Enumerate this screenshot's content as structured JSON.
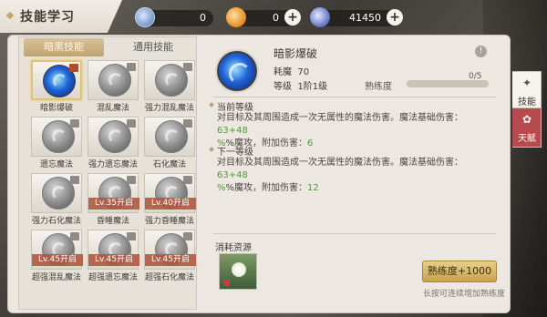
{
  "title": "技能学习",
  "resources": [
    {
      "name": "diamond",
      "value": "0",
      "has_plus": false,
      "icon": "diamond-icon"
    },
    {
      "name": "gold-coin",
      "value": "0",
      "has_plus": true,
      "icon": "coin-icon"
    },
    {
      "name": "silver",
      "value": "41450",
      "has_plus": true,
      "icon": "silver-icon"
    }
  ],
  "tabs": {
    "active": "暗黑技能",
    "inactive": "通用技能"
  },
  "skills": [
    {
      "name": "暗影爆破",
      "lock": "",
      "selected": true
    },
    {
      "name": "混乱魔法",
      "lock": ""
    },
    {
      "name": "强力混乱魔法",
      "lock": ""
    },
    {
      "name": "遗忘魔法",
      "lock": ""
    },
    {
      "name": "强力遗忘魔法",
      "lock": ""
    },
    {
      "name": "石化魔法",
      "lock": ""
    },
    {
      "name": "强力石化魔法",
      "lock": ""
    },
    {
      "name": "昏睡魔法",
      "lock": "Lv.35开启"
    },
    {
      "name": "强力昏睡魔法",
      "lock": "Lv.40开启"
    },
    {
      "name": "超强混乱魔法",
      "lock": "Lv.45开启"
    },
    {
      "name": "超强遗忘魔法",
      "lock": "Lv.45开启"
    },
    {
      "name": "超强石化魔法",
      "lock": "Lv.45开启"
    }
  ],
  "detail": {
    "name": "暗影爆破",
    "cost_label": "耗魔",
    "cost_value": "70",
    "level_label": "等级",
    "level_value": "1阶1级",
    "prof_label": "熟练度",
    "prof_value": "0/5",
    "prof_fraction": 0,
    "current_header": "当前等级",
    "current_text_a": "对目标及其周围造成一次无属性的魔法伤害。魔法基础伤害：",
    "current_dmg": "63+48",
    "current_text_b": "%魔攻，附加伤害：",
    "current_extra": "6",
    "next_header": "下一等级",
    "next_text_a": "对目标及其周围造成一次无属性的魔法伤害。魔法基础伤害：",
    "next_dmg": "63+48",
    "next_text_b": "%魔攻，附加伤害：",
    "next_extra": "12"
  },
  "consume": {
    "header": "消耗资源",
    "button": "熟练度+1000",
    "hint": "长按可连续增加熟练度"
  },
  "side_tabs": [
    {
      "label": "技能",
      "icon": "feather-icon",
      "active": true
    },
    {
      "label": "天赋",
      "icon": "talent-icon",
      "active": false
    }
  ]
}
